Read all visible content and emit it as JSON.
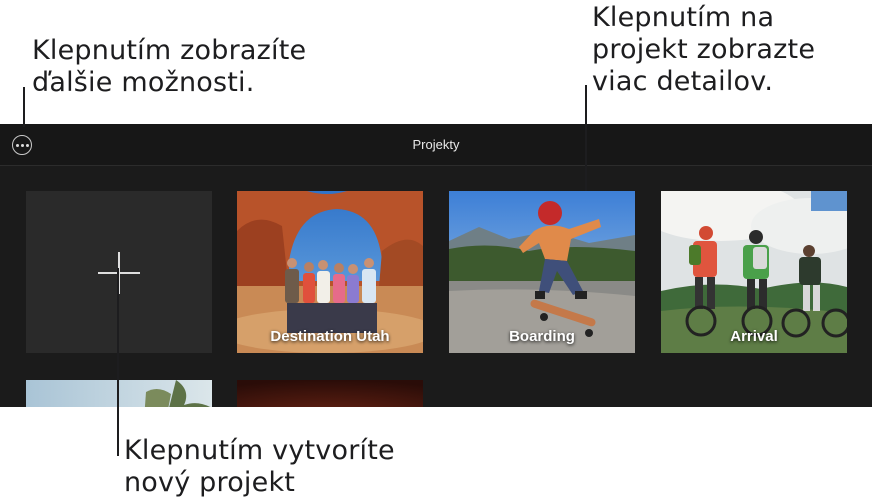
{
  "callouts": {
    "more_options": "Klepnutím zobrazíte\nďalšie možnosti.",
    "project_details": "Klepnutím na\nprojekt zobrazte\nviac detailov.",
    "new_project": "Klepnutím vytvoríte\nnový projekt"
  },
  "titlebar": {
    "title": "Projekty",
    "more_icon": "ellipsis-circle-icon"
  },
  "projects": [
    {
      "label": ""
    },
    {
      "label": "Destination Utah"
    },
    {
      "label": "Boarding"
    },
    {
      "label": "Arrival"
    },
    {
      "label": ""
    },
    {
      "label": ""
    }
  ],
  "new_project_icon": "plus-icon"
}
